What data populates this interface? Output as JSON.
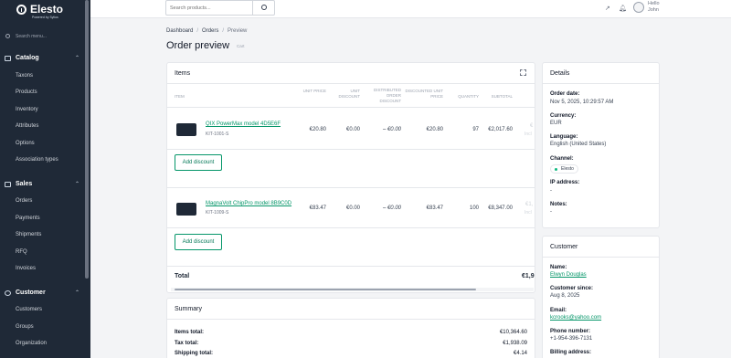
{
  "app": {
    "logo_text": "Elesto",
    "logo_sub": "Powered by Sylius"
  },
  "sidebar": {
    "search_placeholder": "Search menu...",
    "sections": [
      {
        "label": "Catalog",
        "icon": "catalog-icon",
        "items": [
          "Taxons",
          "Products",
          "Inventory",
          "Attributes",
          "Options",
          "Association types"
        ]
      },
      {
        "label": "Sales",
        "icon": "bag-icon",
        "items": [
          "Orders",
          "Payments",
          "Shipments",
          "RFQ",
          "Invoices"
        ]
      },
      {
        "label": "Customer",
        "icon": "user-icon",
        "items": [
          "Customers",
          "Groups",
          "Organization"
        ]
      }
    ]
  },
  "topbar": {
    "search_placeholder": "Search products...",
    "user_greeting": "Hello",
    "user_name": "John"
  },
  "breadcrumb": [
    "Dashboard",
    "Orders",
    "Preview"
  ],
  "page": {
    "title": "Order preview",
    "tag": "Cart"
  },
  "items_card": {
    "title": "Items",
    "columns": [
      "Item",
      "Unit price",
      "Unit discount",
      "Distributed order discount",
      "Discounted unit price",
      "Quantity",
      "Subtotal"
    ],
    "rows": [
      {
        "name": "QIX PowerMax model 4D5E6F",
        "sku": "KIT-1001-S",
        "unit_price": "€20.80",
        "unit_discount": "€0.00",
        "distributed": "– €0.00",
        "discounted": "€20.80",
        "quantity": "97",
        "subtotal": "€2,017.60",
        "cut_value": "€",
        "cut_sub": "Incl"
      },
      {
        "name": "MagnaVolt ChipPro model 8B9C0D",
        "sku": "KIT-1009-S",
        "unit_price": "€83.47",
        "unit_discount": "€0.00",
        "distributed": "– €0.00",
        "discounted": "€83.47",
        "quantity": "100",
        "subtotal": "€8,347.00",
        "cut_value": "€1,",
        "cut_sub": "Incl"
      }
    ],
    "add_discount_label": "Add discount",
    "total_label": "Total",
    "total_value": "€1,9"
  },
  "summary": {
    "title": "Summary",
    "rows": [
      {
        "label": "Items total:",
        "value": "€10,364.60"
      },
      {
        "label": "Tax total:",
        "value": "€1,938.09"
      },
      {
        "label": "Shipping total:",
        "value": "€4.14"
      }
    ]
  },
  "details": {
    "title": "Details",
    "order_date_label": "Order date:",
    "order_date": "Nov 5, 2025, 10:29:57 AM",
    "currency_label": "Currency:",
    "currency": "EUR",
    "language_label": "Language:",
    "language": "English (United States)",
    "channel_label": "Channel:",
    "channel": "Elesto",
    "ip_label": "IP address:",
    "ip": "-",
    "notes_label": "Notes:",
    "notes": "-"
  },
  "customer": {
    "title": "Customer",
    "name_label": "Name:",
    "name": "Elwyn Douglas",
    "since_label": "Customer since:",
    "since": "Aug 8, 2025",
    "email_label": "Email:",
    "email": "kcrooks@yahoo.com",
    "phone_label": "Phone number:",
    "phone": "+1-954-396-7131",
    "billing_label": "Billing address:"
  }
}
